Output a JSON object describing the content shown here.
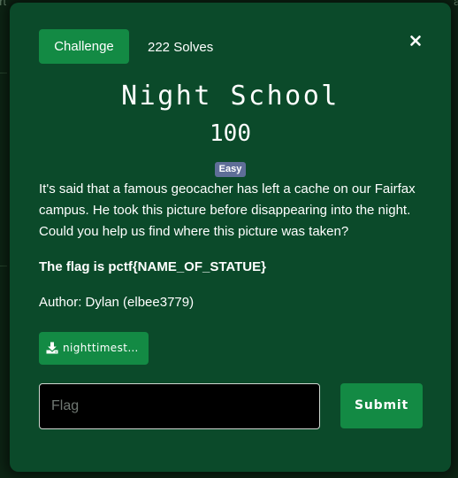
{
  "background": {
    "left_text": "art",
    "right_text": "at"
  },
  "modal": {
    "tabs": {
      "challenge_label": "Challenge",
      "solves_label": "222 Solves"
    },
    "close_icon": "close-icon",
    "challenge": {
      "name": "Night School",
      "points": "100",
      "difficulty": "Easy",
      "description": "It's said that a famous geocacher has left a cache on our Fairfax campus. He took this picture before disappearing into the night. Could you help us find where this picture was taken?",
      "flag_format": "The flag is pctf{NAME_OF_STATUE}",
      "author": "Author: Dylan (elbee3779)"
    },
    "file": {
      "icon": "download-icon",
      "name": "nighttimestatue.jpg"
    },
    "form": {
      "flag_placeholder": "Flag",
      "flag_value": "",
      "submit_label": "Submit"
    }
  },
  "colors": {
    "modal_bg": "#0b4a2a",
    "accent": "#138a44",
    "difficulty_badge": "#5f6e98"
  }
}
